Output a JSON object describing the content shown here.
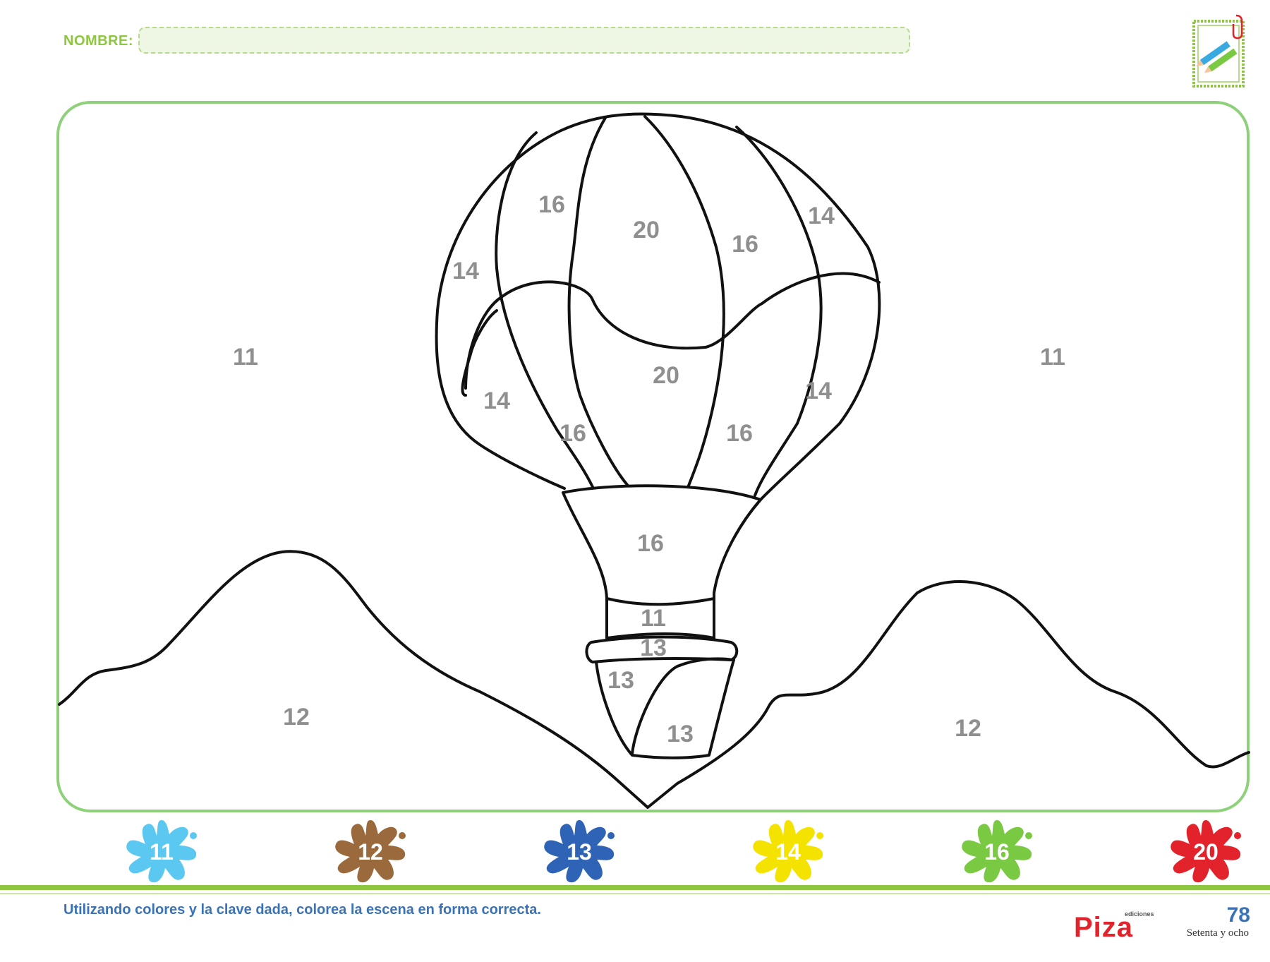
{
  "header": {
    "name_label": "NOMBRE:",
    "name_value": ""
  },
  "scene": {
    "region_numbers": {
      "sky_left": "11",
      "sky_right": "11",
      "mountain_left": "12",
      "mountain_right": "12",
      "balloon_top_left_16": "16",
      "balloon_top_center_20": "20",
      "balloon_top_right_16": "16",
      "balloon_top_right_14": "14",
      "balloon_left_14": "14",
      "balloon_center_20": "20",
      "balloon_lower_left_14": "14",
      "balloon_lower_left_16": "16",
      "balloon_lower_right_16": "16",
      "balloon_lower_right_14": "14",
      "skirt_16": "16",
      "ropes_11": "11",
      "basket_rim_13": "13",
      "basket_left_13": "13",
      "basket_right_13": "13"
    }
  },
  "color_key": [
    {
      "number": "11",
      "color": "#5ac8f0"
    },
    {
      "number": "12",
      "color": "#9b6a3c"
    },
    {
      "number": "13",
      "color": "#2f63b6"
    },
    {
      "number": "14",
      "color": "#f4e300"
    },
    {
      "number": "16",
      "color": "#7ac943"
    },
    {
      "number": "20",
      "color": "#e3232c"
    }
  ],
  "footer": {
    "instruction": "Utilizando colores y la clave dada, colorea la escena en forma correcta.",
    "logo_small": "ediciones",
    "logo_text": "Piza",
    "page_number": "78",
    "page_words": "Setenta y ocho"
  }
}
